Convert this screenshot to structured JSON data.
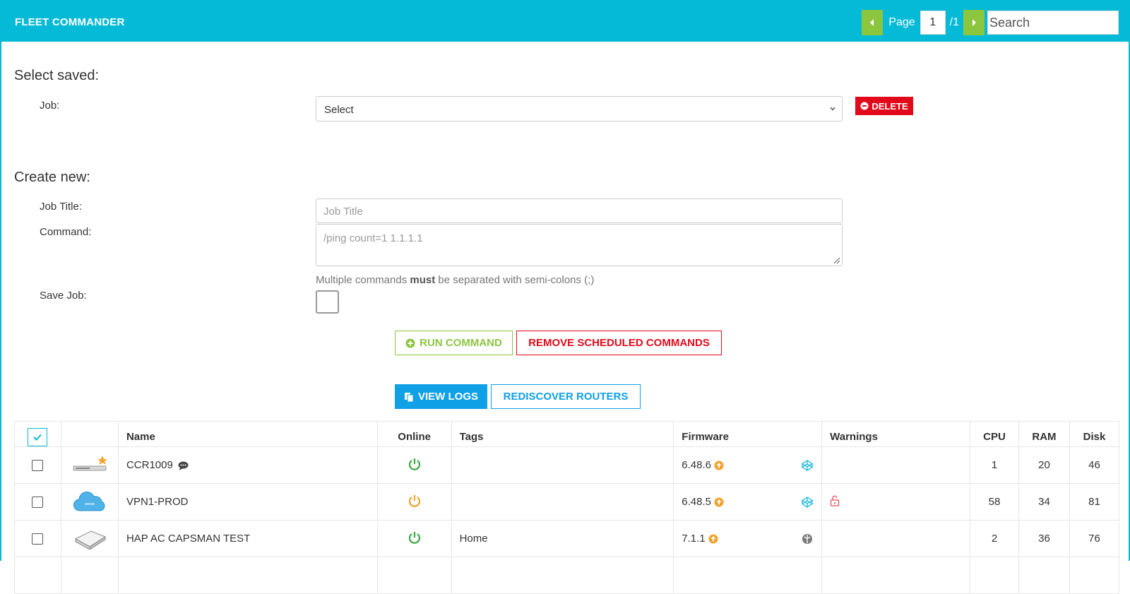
{
  "app": {
    "title": "FLEET COMMANDER"
  },
  "pager": {
    "page_label": "Page",
    "current_page": "1",
    "total": "/1",
    "search_placeholder": "Search"
  },
  "saved": {
    "heading": "Select saved:",
    "job_label": "Job:",
    "job_select_value": "Select",
    "delete_label": "DELETE"
  },
  "create": {
    "heading": "Create new:",
    "title_label": "Job Title:",
    "title_placeholder": "Job Title",
    "command_label": "Command:",
    "command_placeholder": "/ping count=1 1.1.1.1",
    "help_pre": "Multiple commands",
    "help_bold": "must",
    "help_post": "be separated with semi-colons (;)",
    "save_label": "Save Job:",
    "run_label": "RUN COMMAND",
    "remove_label": "REMOVE SCHEDULED COMMANDS",
    "logs_label": "VIEW LOGS",
    "rediscover_label": "REDISCOVER ROUTERS"
  },
  "table": {
    "columns": [
      "",
      "",
      "Name",
      "Online",
      "Tags",
      "Firmware",
      "Warnings",
      "CPU",
      "RAM",
      "Disk"
    ],
    "rows": [
      {
        "name": "CCR1009",
        "online": "green",
        "tags": "",
        "firmware": "6.48.6",
        "cpu": "1",
        "ram": "20",
        "disk": "46",
        "device": "rack-router",
        "starred": true,
        "comment": true,
        "warning": ""
      },
      {
        "name": "VPN1-PROD",
        "online": "orange",
        "tags": "",
        "firmware": "6.48.5",
        "cpu": "58",
        "ram": "34",
        "disk": "81",
        "device": "cloud",
        "starred": false,
        "comment": false,
        "warning": "lock"
      },
      {
        "name": "HAP AC CAPSMAN TEST",
        "online": "green",
        "tags": "Home",
        "firmware": "7.1.1",
        "cpu": "2",
        "ram": "36",
        "disk": "76",
        "device": "hap",
        "starred": false,
        "comment": false,
        "warning": ""
      }
    ]
  },
  "colors": {
    "brand": "#05bad6",
    "green": "#8cc63f",
    "red": "#e2091b",
    "blue": "#0fa0e6"
  }
}
